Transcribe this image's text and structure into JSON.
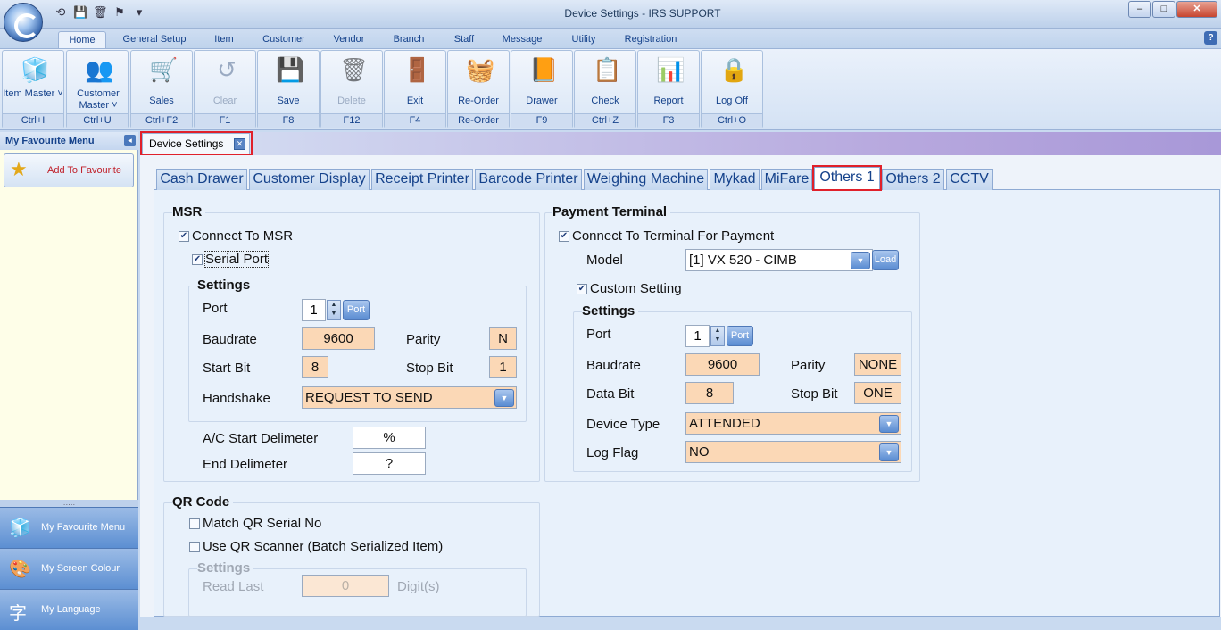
{
  "window": {
    "title": "Device Settings - IRS SUPPORT",
    "minimize": "–",
    "maximize": "□",
    "close": "✕"
  },
  "qat": {
    "icons": [
      "undo-icon",
      "save-icon",
      "trash-icon",
      "flag-icon",
      "dropdown-icon"
    ],
    "glyphs": [
      "⟲",
      "💾",
      "🗑",
      "⚑",
      "▾"
    ]
  },
  "menu_tabs": [
    "Home",
    "General Setup",
    "Item",
    "Customer",
    "Vendor",
    "Branch",
    "Staff",
    "Message",
    "Utility",
    "Registration"
  ],
  "help": "?",
  "ribbon": [
    {
      "label": "Item Master ˅",
      "shortcut": "Ctrl+I",
      "icon": "item-master-icon",
      "glyph": "🧊",
      "enabled": true
    },
    {
      "label": "Customer Master ˅",
      "shortcut": "Ctrl+U",
      "icon": "customer-icon",
      "glyph": "👥",
      "enabled": true
    },
    {
      "label": "Sales",
      "shortcut": "Ctrl+F2",
      "icon": "cart-icon",
      "glyph": "🛒",
      "enabled": true
    },
    {
      "label": "Clear",
      "shortcut": "F1",
      "icon": "clear-icon",
      "glyph": "↺",
      "enabled": false
    },
    {
      "label": "Save",
      "shortcut": "F8",
      "icon": "save-icon",
      "glyph": "💾",
      "enabled": true
    },
    {
      "label": "Delete",
      "shortcut": "F12",
      "icon": "trash-icon",
      "glyph": "🗑",
      "enabled": false
    },
    {
      "label": "Exit",
      "shortcut": "F4",
      "icon": "exit-door-icon",
      "glyph": "🚪",
      "enabled": true
    },
    {
      "label": "Re-Order",
      "shortcut": "Re-Order",
      "icon": "basket-icon",
      "glyph": "🧺",
      "enabled": true
    },
    {
      "label": "Drawer",
      "shortcut": "F9",
      "icon": "drawer-icon",
      "glyph": "📙",
      "enabled": true
    },
    {
      "label": "Check",
      "shortcut": "Ctrl+Z",
      "icon": "checklist-icon",
      "glyph": "📋",
      "enabled": true
    },
    {
      "label": "Report",
      "shortcut": "F3",
      "icon": "report-chart-icon",
      "glyph": "📊",
      "enabled": true
    },
    {
      "label": "Log Off",
      "shortcut": "Ctrl+O",
      "icon": "lock-icon",
      "glyph": "🔒",
      "enabled": true
    }
  ],
  "sidebar": {
    "header": "My Favourite Menu",
    "collapse": "◂",
    "add_favourite": "Add To Favourite",
    "splitter": "․․․․․",
    "nav": [
      {
        "label": "My Favourite Menu",
        "glyph": "🧊"
      },
      {
        "label": "My Screen Colour",
        "glyph": "🎨"
      },
      {
        "label": "My Language",
        "glyph": "字"
      }
    ]
  },
  "document_tab": {
    "label": "Device Settings",
    "close": "✕"
  },
  "page_tabs": [
    "Cash Drawer",
    "Customer Display",
    "Receipt Printer",
    "Barcode Printer",
    "Weighing Machine",
    "Mykad",
    "MiFare",
    "Others 1",
    "Others 2",
    "CCTV"
  ],
  "msr": {
    "title": "MSR",
    "connect": "Connect To MSR",
    "serial_port": "Serial Port",
    "settings_title": "Settings",
    "port_label": "Port",
    "port_value": "1",
    "port_button": "Port",
    "baudrate_label": "Baudrate",
    "baudrate_value": "9600",
    "parity_label": "Parity",
    "parity_value": "N",
    "start_bit_label": "Start Bit",
    "start_bit_value": "8",
    "stop_bit_label": "Stop Bit",
    "stop_bit_value": "1",
    "handshake_label": "Handshake",
    "handshake_value": "REQUEST TO SEND",
    "ac_start_label": "A/C Start Delimeter",
    "ac_start_value": "%",
    "end_delim_label": "End Delimeter",
    "end_delim_value": "?"
  },
  "payment": {
    "title": "Payment Terminal",
    "connect": "Connect To Terminal For Payment",
    "model_label": "Model",
    "model_value": "[1] VX 520 - CIMB",
    "load_button": "Load",
    "custom_setting": "Custom Setting",
    "settings_title": "Settings",
    "port_label": "Port",
    "port_value": "1",
    "port_button": "Port",
    "baudrate_label": "Baudrate",
    "baudrate_value": "9600",
    "parity_label": "Parity",
    "parity_value": "NONE",
    "data_bit_label": "Data Bit",
    "data_bit_value": "8",
    "stop_bit_label": "Stop Bit",
    "stop_bit_value": "ONE",
    "device_type_label": "Device Type",
    "device_type_value": "ATTENDED",
    "log_flag_label": "Log Flag",
    "log_flag_value": "NO"
  },
  "qr": {
    "title": "QR Code",
    "match_serial": "Match QR Serial No",
    "use_scanner": "Use QR Scanner (Batch Serialized Item)",
    "settings_title": "Settings",
    "read_last_label": "Read Last",
    "read_last_value": "0",
    "digits_label": "Digit(s)"
  },
  "dropdown_glyph": "▼",
  "spin_up": "▲",
  "spin_down": "▼"
}
